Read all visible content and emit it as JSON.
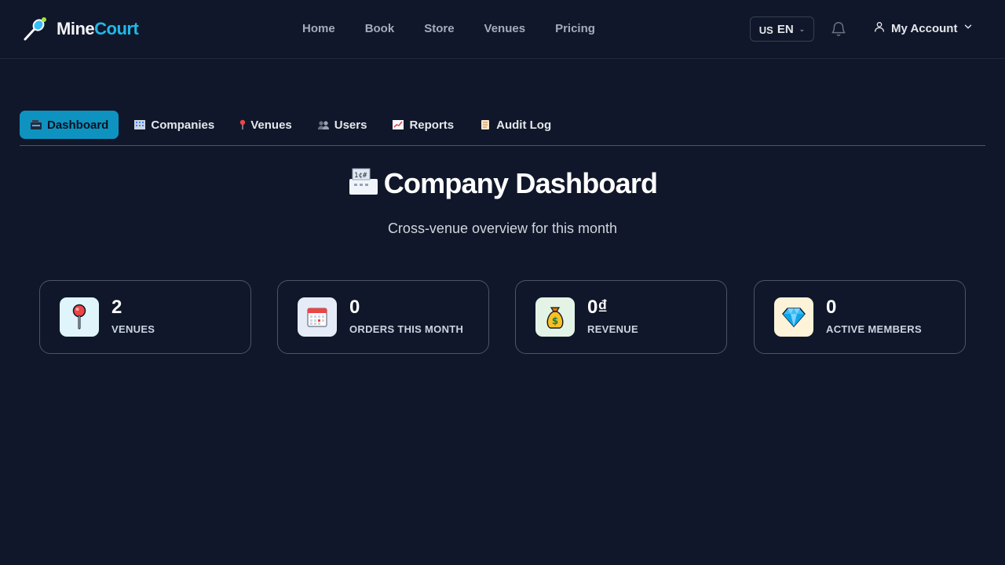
{
  "brand": {
    "part1": "Mine",
    "part2": "Court"
  },
  "nav": {
    "links": [
      "Home",
      "Book",
      "Store",
      "Venues",
      "Pricing"
    ]
  },
  "lang": {
    "flag": "US",
    "code": "EN"
  },
  "account": {
    "label": "My Account"
  },
  "tabs": [
    {
      "label": "Dashboard",
      "icon": "cash-register-icon",
      "active": true
    },
    {
      "label": "Companies",
      "icon": "office-building-icon",
      "active": false
    },
    {
      "label": "Venues",
      "icon": "round-pushpin-icon",
      "active": false
    },
    {
      "label": "Users",
      "icon": "users-icon",
      "active": false
    },
    {
      "label": "Reports",
      "icon": "chart-increasing-icon",
      "active": false
    },
    {
      "label": "Audit Log",
      "icon": "scroll-icon",
      "active": false
    }
  ],
  "page": {
    "title": "Company Dashboard",
    "subtitle": "Cross-venue overview for this month"
  },
  "stats": [
    {
      "value": "2",
      "label": "VENUES",
      "icon": "pushpin-icon",
      "icon_bg": "#dff5fb"
    },
    {
      "value": "0",
      "label": "ORDERS THIS MONTH",
      "icon": "calendar-icon",
      "icon_bg": "#e6ecf7"
    },
    {
      "value": "0₫",
      "label": "REVENUE",
      "icon": "money-bag-icon",
      "icon_bg": "#e3f4e6"
    },
    {
      "value": "0",
      "label": "ACTIVE MEMBERS",
      "icon": "gem-icon",
      "icon_bg": "#fdf3d8"
    }
  ],
  "colors": {
    "background": "#10172a",
    "accent": "#0e93c0",
    "brand_court": "#22b8e8"
  }
}
